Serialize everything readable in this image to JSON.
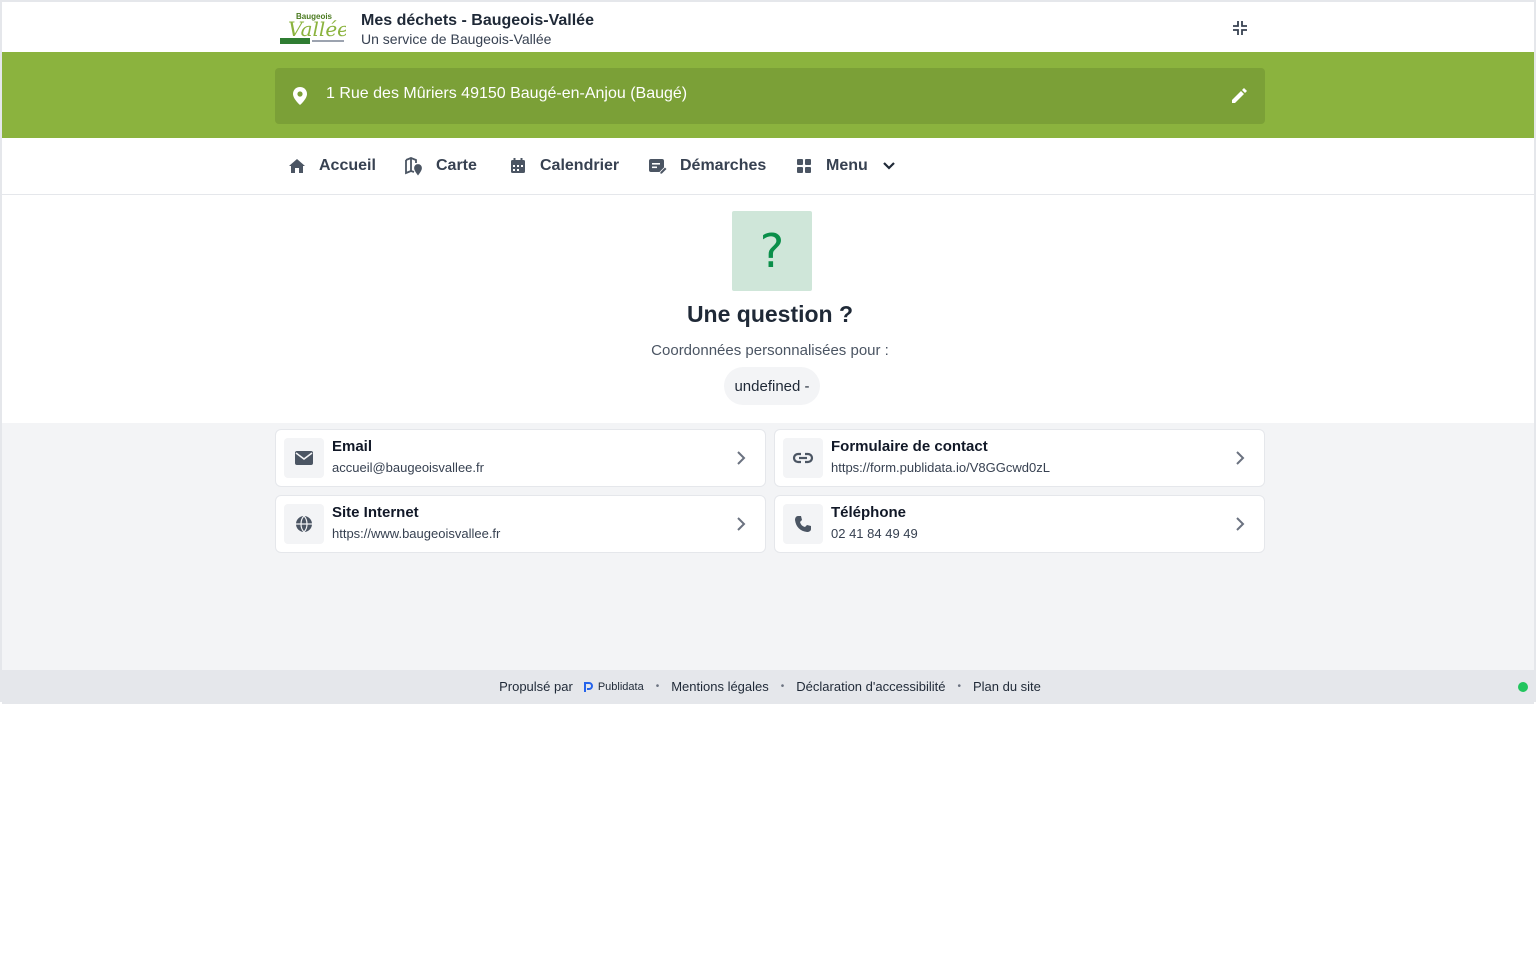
{
  "header": {
    "title": "Mes déchets - Baugeois-Vallée",
    "subtitle": "Un service de Baugeois-Vallée",
    "logo_text": "Baugeois Vallée"
  },
  "address": {
    "text": "1 Rue des Mûriers 49150 Baugé-en-Anjou (Baugé)"
  },
  "nav": {
    "items": [
      {
        "label": "Accueil",
        "icon": "home-icon"
      },
      {
        "label": "Carte",
        "icon": "map-pin-icon"
      },
      {
        "label": "Calendrier",
        "icon": "calendar-icon"
      },
      {
        "label": "Démarches",
        "icon": "edit-form-icon"
      },
      {
        "label": "Menu",
        "icon": "grid-icon"
      }
    ]
  },
  "hero": {
    "icon_glyph": "?",
    "title": "Une question ?",
    "subtitle": "Coordonnées personnalisées pour :",
    "pill": "undefined -"
  },
  "contacts": [
    {
      "title": "Email",
      "value": "accueil@baugeoisvallee.fr",
      "icon": "envelope-icon"
    },
    {
      "title": "Formulaire de contact",
      "value": "https://form.publidata.io/V8GGcwd0zL",
      "icon": "link-icon"
    },
    {
      "title": "Site Internet",
      "value": "https://www.baugeoisvallee.fr",
      "icon": "globe-icon"
    },
    {
      "title": "Téléphone",
      "value": "02 41 84 49 49",
      "icon": "phone-icon"
    }
  ],
  "footer": {
    "powered_by": "Propulsé par",
    "brand": "Publidata",
    "links": [
      "Mentions légales",
      "Déclaration d'accessibilité",
      "Plan du site"
    ]
  },
  "colors": {
    "green_band": "#8bb33e",
    "address_bar": "#7ba037",
    "question_box": "#cfe6d9",
    "question_mark": "#0a8f4a",
    "status": "#22c55e"
  }
}
